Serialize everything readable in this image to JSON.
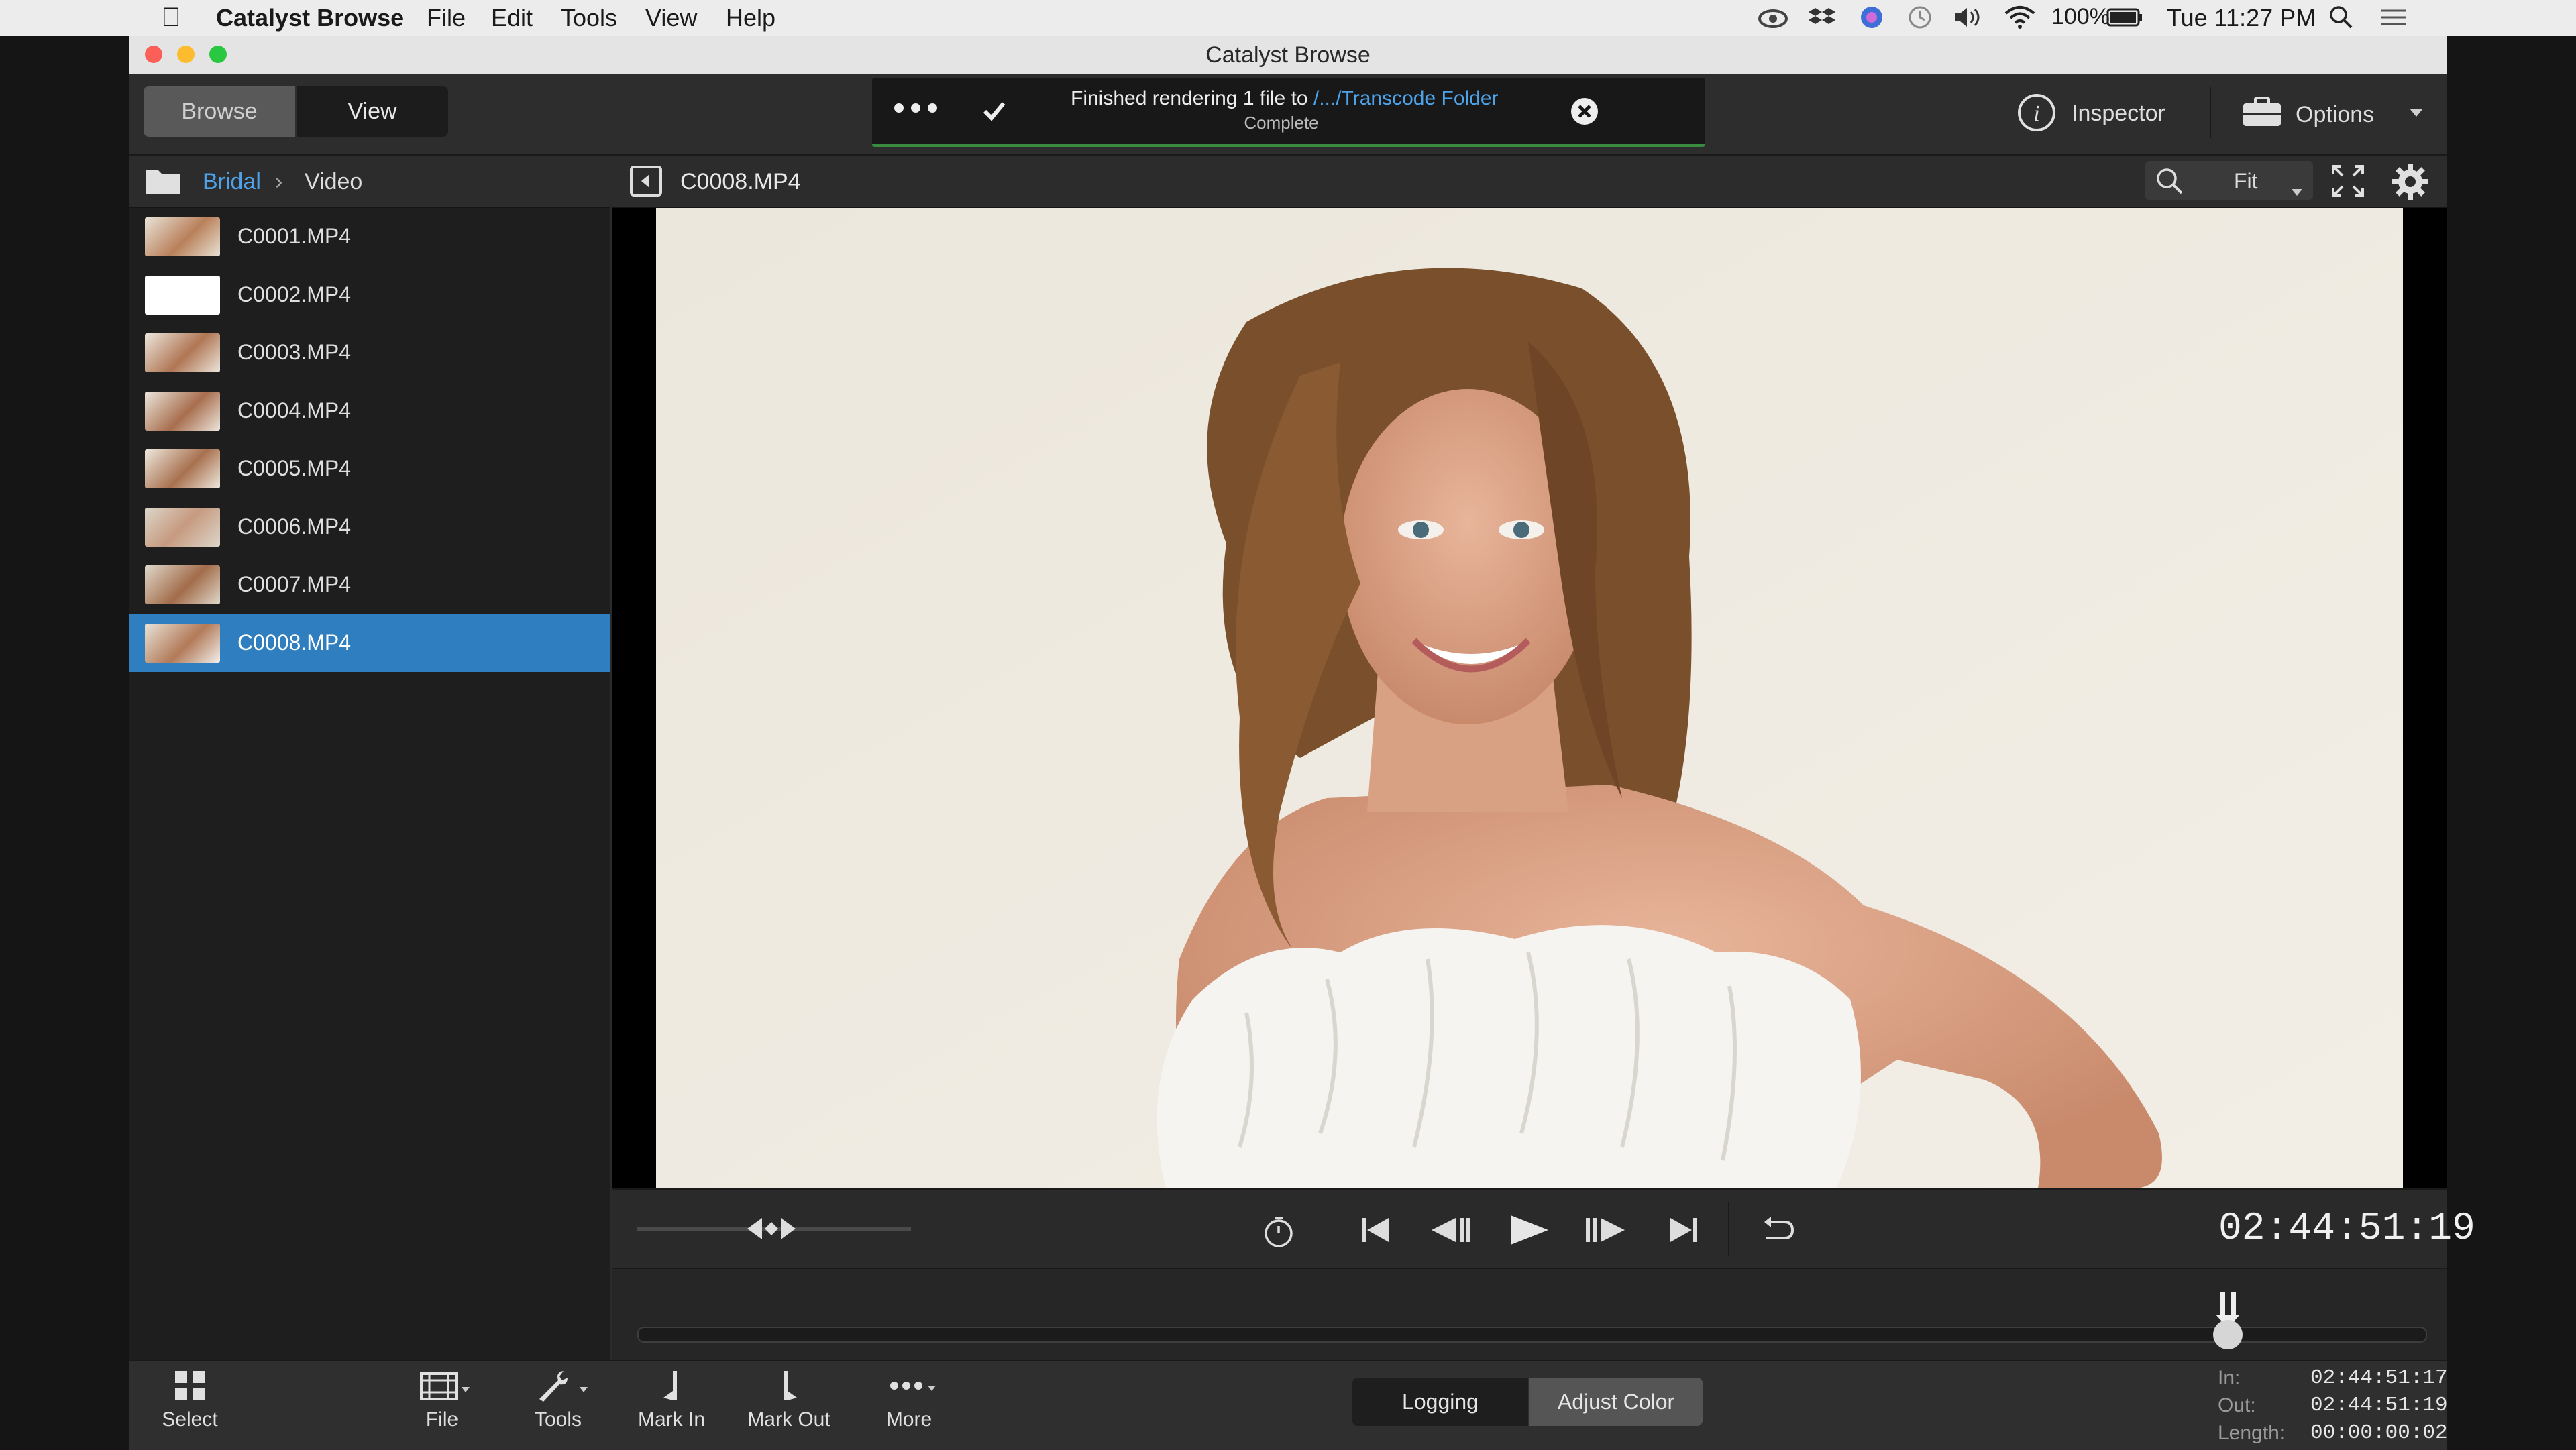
{
  "menubar": {
    "app_name": "Catalyst Browse",
    "menus": [
      "File",
      "Edit",
      "Tools",
      "View",
      "Help"
    ],
    "battery": "100%",
    "clock": "Tue 11:27 PM"
  },
  "window": {
    "title": "Catalyst Browse"
  },
  "toolbar": {
    "browse_label": "Browse",
    "view_label": "View",
    "inspector_label": "Inspector",
    "options_label": "Options"
  },
  "status": {
    "message_prefix": "Finished rendering 1 file to ",
    "link_text": "/.../Transcode Folder",
    "sub_text": "Complete"
  },
  "breadcrumb": {
    "parent": "Bridal",
    "current": "Video"
  },
  "files": [
    {
      "name": "C0001.MP4",
      "selected": false
    },
    {
      "name": "C0002.MP4",
      "selected": false
    },
    {
      "name": "C0003.MP4",
      "selected": false
    },
    {
      "name": "C0004.MP4",
      "selected": false
    },
    {
      "name": "C0005.MP4",
      "selected": false
    },
    {
      "name": "C0006.MP4",
      "selected": false
    },
    {
      "name": "C0007.MP4",
      "selected": false
    },
    {
      "name": "C0008.MP4",
      "selected": true
    }
  ],
  "viewer": {
    "clip_name": "C0008.MP4",
    "zoom": "Fit"
  },
  "transport": {
    "timecode": "02:44:51:19"
  },
  "bottom": {
    "select_label": "Select",
    "file_label": "File",
    "tools_label": "Tools",
    "mark_in_label": "Mark In",
    "mark_out_label": "Mark Out",
    "more_label": "More",
    "logging_label": "Logging",
    "adjust_color_label": "Adjust Color",
    "in_label": "In:",
    "in_value": "02:44:51:17",
    "out_label": "Out:",
    "out_value": "02:44:51:19",
    "length_label": "Length:",
    "length_value": "00:00:00:02"
  },
  "playhead_fraction": 0.89,
  "colors": {
    "selection": "#2f7fc0",
    "link": "#4ea3e8",
    "status_ok": "#3a8a3f"
  }
}
